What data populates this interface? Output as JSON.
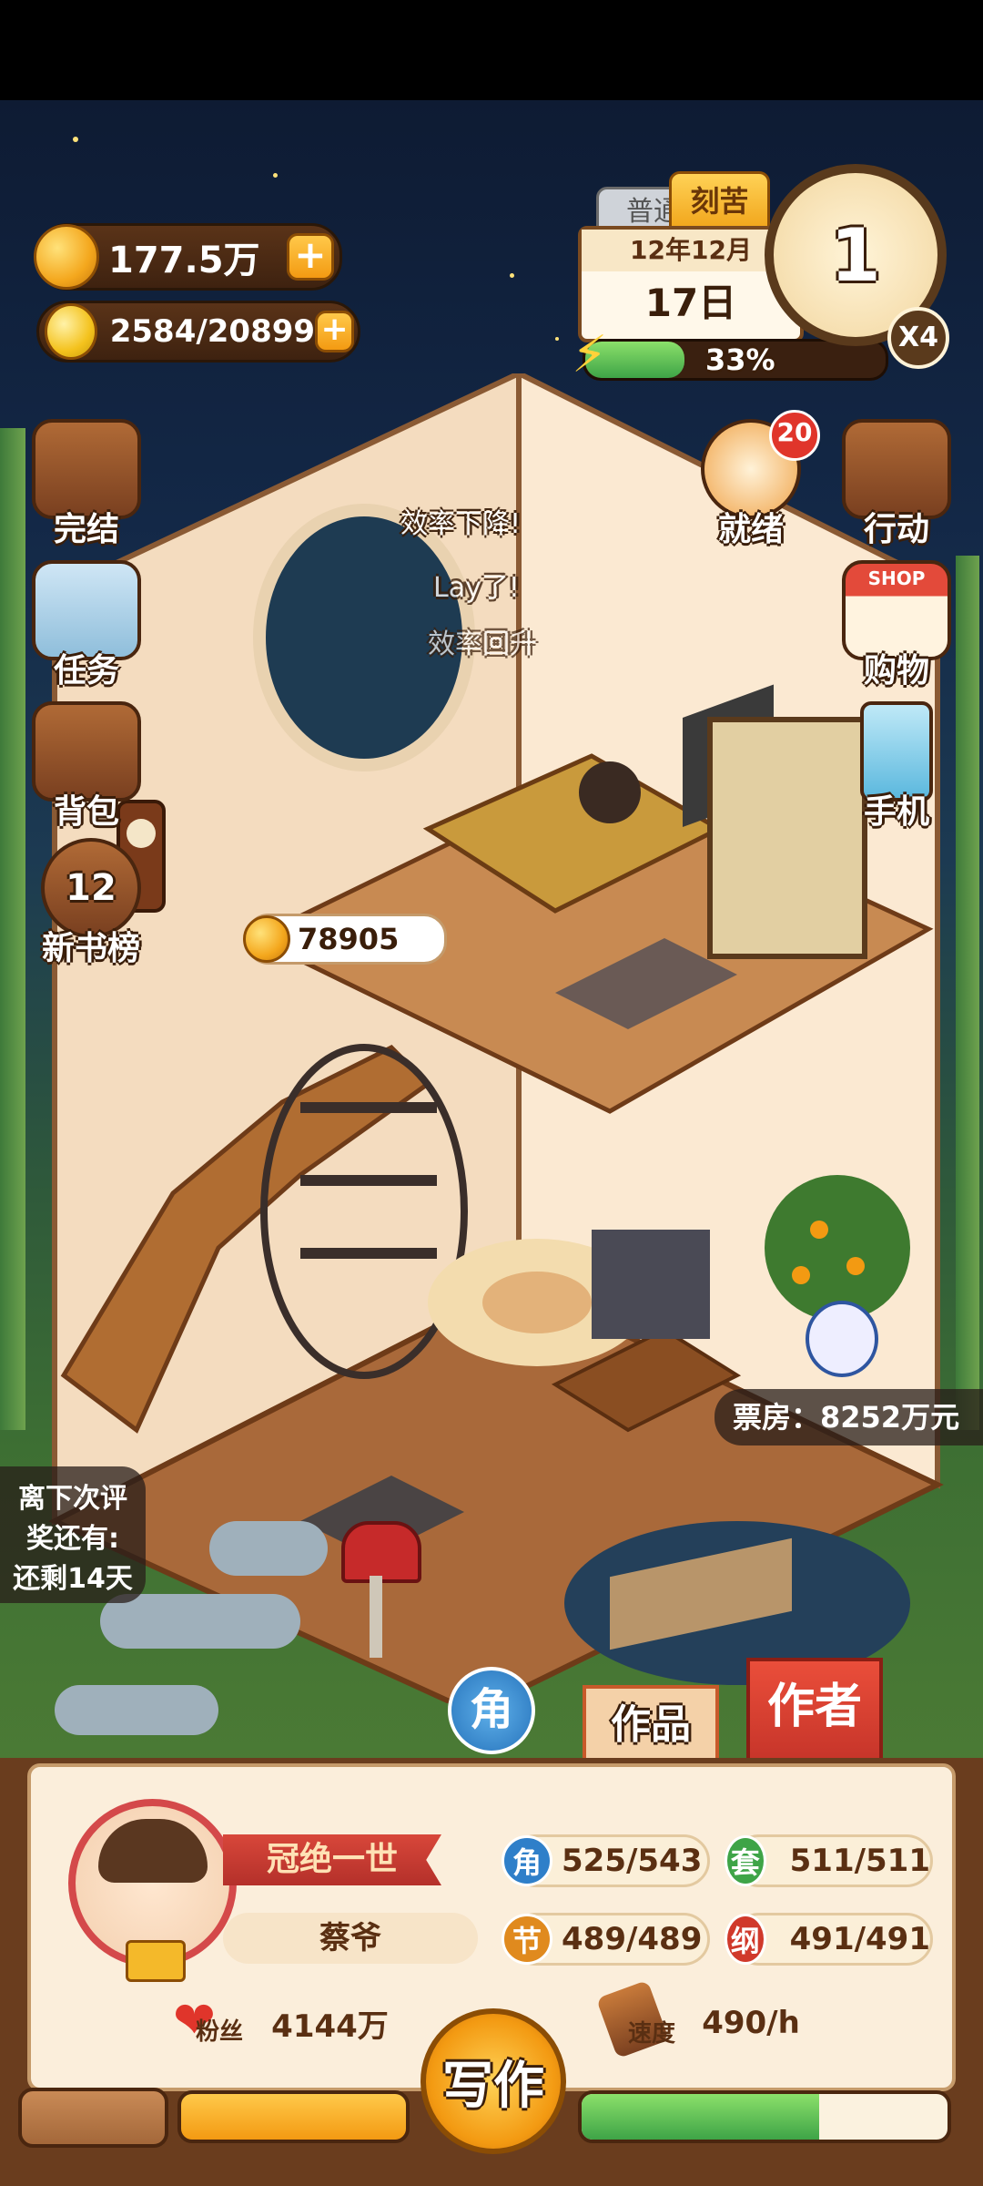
{
  "currency": {
    "money": "177.5万",
    "inspiration": "2584/20899"
  },
  "calendar": {
    "mode_normal": "普通",
    "mode_hard": "刻苦",
    "year_month": "12年12月",
    "day": "17日",
    "progress_percent": 33,
    "progress_text": "33%",
    "clock_value": "1",
    "speed_multiplier": "X4"
  },
  "left_menu": [
    {
      "label": "完结",
      "icon": "book-icon"
    },
    {
      "label": "任务",
      "icon": "checklist-icon"
    },
    {
      "label": "背包",
      "icon": "bag-icon"
    },
    {
      "label": "新书榜",
      "icon": "ranking-badge-icon",
      "badge": "12"
    }
  ],
  "right_menu": [
    {
      "label": "就绪",
      "icon": "timer-icon",
      "badge": "20"
    },
    {
      "label": "行动",
      "icon": "door-icon"
    },
    {
      "label": "购物",
      "icon": "shop-icon",
      "sign": "SHOP"
    },
    {
      "label": "手机",
      "icon": "phone-icon"
    }
  ],
  "floating_texts": [
    "效率下降!",
    "Lay了!",
    "效率回升"
  ],
  "bookshelf_coin": "78905",
  "box_office": "票房：8252万元",
  "award_countdown": {
    "line1": "离下次评",
    "line2": "奖还有:",
    "line3": "还剩14天"
  },
  "tabs": {
    "role": "角",
    "works": "作品",
    "author": "作者"
  },
  "profile": {
    "title": "冠绝一世",
    "name": "蔡爷",
    "fans_label": "粉丝",
    "fans": "4144万",
    "speed_label": "速度",
    "speed": "490/h"
  },
  "stats": [
    {
      "badge": "角",
      "value": "525/543",
      "color": "#2f7fc9"
    },
    {
      "badge": "套",
      "value": "511/511",
      "color": "#3ea447"
    },
    {
      "badge": "节",
      "value": "489/489",
      "color": "#e08a1e"
    },
    {
      "badge": "纲",
      "value": "491/491",
      "color": "#d0392b"
    }
  ],
  "write_button": "写作",
  "bottom_bar": {
    "orange_fill": 1.0,
    "green_fill": 0.65
  }
}
